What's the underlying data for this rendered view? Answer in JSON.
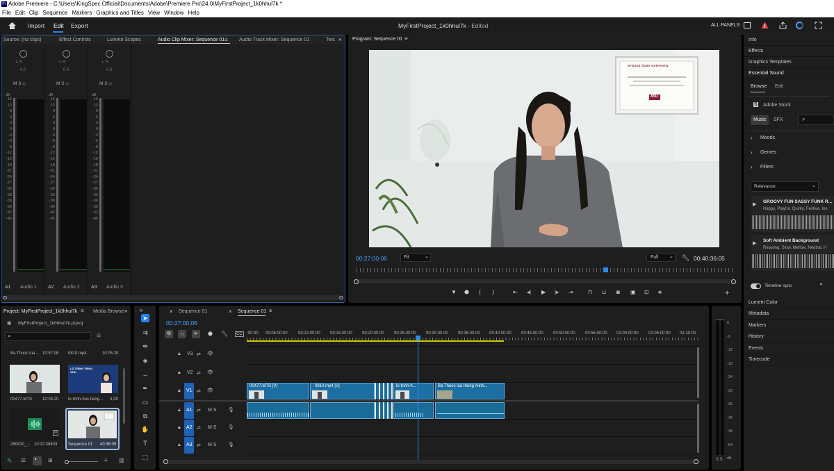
{
  "window": {
    "title": "Adobe Premiere - C:\\Users\\KingSpec Official\\Documents\\Adobe\\Premiere Pro\\24.0\\MyFirstProject_1k0hhul7k *",
    "logo": "Pr"
  },
  "menu": [
    "File",
    "Edit",
    "Clip",
    "Sequence",
    "Markers",
    "Graphics and Titles",
    "View",
    "Window",
    "Help"
  ],
  "header": {
    "import": "Import",
    "edit": "Edit",
    "export": "Export",
    "project_title": "MyFirstProject_1k0hhul7k",
    "status": "- Edited",
    "all_panels": "ALL PANELS"
  },
  "source_tabs": [
    "Source: (no clips)",
    "Effect Controls",
    "Lumetri Scopes",
    "Audio Clip Mixer: Sequence 01",
    "Audio Track Mixer: Sequence 01",
    "Text"
  ],
  "mixer": {
    "lr": "L   R",
    "val": "0.0",
    "msr": "M  S  ◇",
    "db": "dB",
    "scale": [
      "15",
      "12",
      "9",
      "6",
      "3",
      "0",
      "-3",
      "-6",
      "-9",
      "-12",
      "-15",
      "-18",
      "-21",
      "-24",
      "-27",
      "-30",
      "-33",
      "-36",
      "-39",
      "-42",
      "-45"
    ],
    "channels": [
      {
        "code": "A1",
        "name": "Audio 1"
      },
      {
        "code": "A2",
        "name": "Audio 2"
      },
      {
        "code": "A3",
        "name": "Audio 3"
      }
    ]
  },
  "program": {
    "tab": "Program: Sequence 01",
    "timecode": "00:27:00:06",
    "fit": "Fit",
    "quality": "Full",
    "duration": "00:40:36:05",
    "cert_title": "Arizona State University",
    "cert_logo": "ASU"
  },
  "project": {
    "tab": "Project: MyFirstProject_1k0hhul7k",
    "tab2": "Media Browse",
    "file": "MyFirstProject_1k0hhul7k.prproj",
    "top_items": [
      {
        "name": "Ba Thuoc lua ...",
        "dur": "10:57:08"
      },
      {
        "name": "0810.mp4",
        "dur": "10:05:20"
      }
    ],
    "items": [
      {
        "name": "00477.MTS",
        "dur": "10:05:20"
      },
      {
        "name": "lo-trinh-hoc-tieng...",
        "dur": "4;29"
      },
      {
        "name": "260810_...",
        "dur": "10:22:38633"
      },
      {
        "name": "Sequence 01",
        "dur": "40:36:05"
      }
    ],
    "thumb_text": "LỘ TRÌNH TIẾNG ANH"
  },
  "timeline": {
    "tabs": [
      "Sequence 01",
      "Sequence 01"
    ],
    "timecode": "00:27:00:06",
    "ruler": [
      ":00:00",
      "00:05:00:00",
      "00:10:00:00",
      "00:15:00:00",
      "00:20:00:00",
      "00:25:00:00",
      "00:30:00:00",
      "00:35:00:00",
      "00:40:00:00",
      "00:45:00:00",
      "00:50:00:00",
      "00:55:00:00",
      "01:00:00:00",
      "01:05:00:00",
      "01:10:00"
    ],
    "tracks": [
      "V3",
      "V2",
      "V1",
      "A1",
      "A2",
      "A3"
    ],
    "clips": [
      {
        "label": "00477.MTS [V]"
      },
      {
        "label": "0810.mp4 [V]"
      },
      {
        "label": "lo-trinh-h..."
      },
      {
        "label": "Ba Thuoc lua thong minh..."
      }
    ],
    "ms": "M  S",
    "meter_scale": [
      "0",
      "-6",
      "-12",
      "-18",
      "-24",
      "-30",
      "-36",
      "-42",
      "-48",
      "-54",
      "dB"
    ],
    "ss": "S  S"
  },
  "right_panel": {
    "items": [
      "Info",
      "Effects",
      "Graphics Templates",
      "Essential Sound"
    ],
    "browse": "Browse",
    "edit": "Edit",
    "adobe_stock": "Adobe Stock",
    "music": "Music",
    "sfx": "SFX",
    "sections": [
      "Moods",
      "Genres",
      "Filters"
    ],
    "sort": "Relevance",
    "tracks": [
      {
        "title": "GROOVY FUN SASSY FUNK R...",
        "tags": "Happy, Playful, Quirky, Festive, Ins"
      },
      {
        "title": "Soft Ambient Background",
        "tags": "Relaxing, Slow, Mellow, Neutral, H"
      }
    ],
    "timeline_sync": "Timeline sync",
    "bottom_items": [
      "Lumetri Color",
      "Metadata",
      "Markers",
      "History",
      "Events",
      "Timecode"
    ]
  },
  "colors": {
    "accent": "#2680eb",
    "clip_v": "#1d6fa3",
    "clip_a": "#1a6c98",
    "playhead": "#2d8ceb"
  }
}
